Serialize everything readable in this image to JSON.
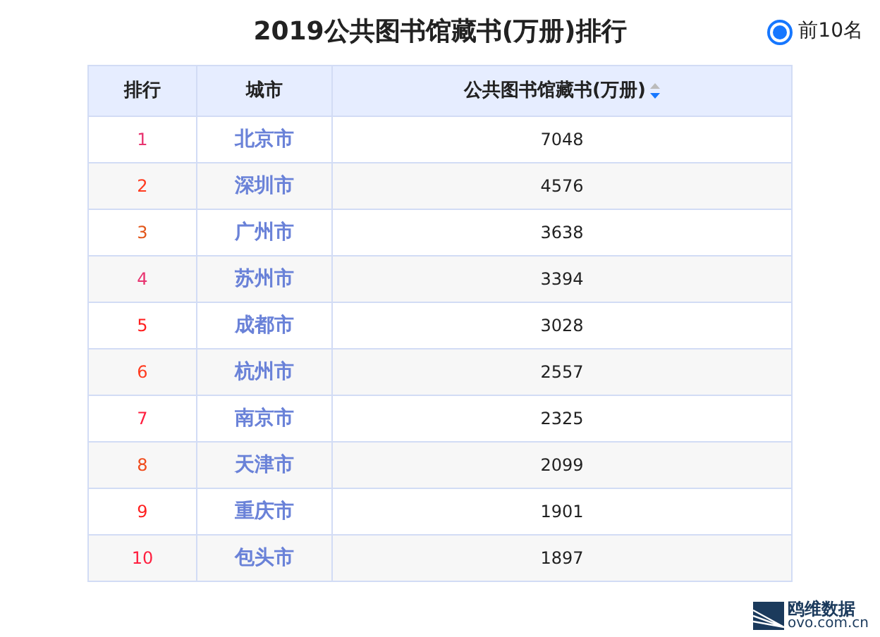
{
  "title": "2019公共图书馆藏书(万册)排行",
  "filter": {
    "label": "前10名",
    "selected": true
  },
  "table": {
    "columns": [
      "排行",
      "城市",
      "公共图书馆藏书(万册)"
    ],
    "rows": [
      {
        "rank": "1",
        "city": "北京市",
        "value": "7048",
        "color": "#e8336f"
      },
      {
        "rank": "2",
        "city": "深圳市",
        "value": "4576",
        "color": "#ff3b1f"
      },
      {
        "rank": "3",
        "city": "广州市",
        "value": "3638",
        "color": "#e2561a"
      },
      {
        "rank": "4",
        "city": "苏州市",
        "value": "3394",
        "color": "#e8336f"
      },
      {
        "rank": "5",
        "city": "成都市",
        "value": "3028",
        "color": "#ff1f1f"
      },
      {
        "rank": "6",
        "city": "杭州市",
        "value": "2557",
        "color": "#ff3b1f"
      },
      {
        "rank": "7",
        "city": "南京市",
        "value": "2325",
        "color": "#ff1f3f"
      },
      {
        "rank": "8",
        "city": "天津市",
        "value": "2099",
        "color": "#f04a1a"
      },
      {
        "rank": "9",
        "city": "重庆市",
        "value": "1901",
        "color": "#ff1f1f"
      },
      {
        "rank": "10",
        "city": "包头市",
        "value": "1897",
        "color": "#ff1f3f"
      }
    ]
  },
  "logo": {
    "name": "鸥维数据",
    "url": "ovo.com.cn"
  }
}
